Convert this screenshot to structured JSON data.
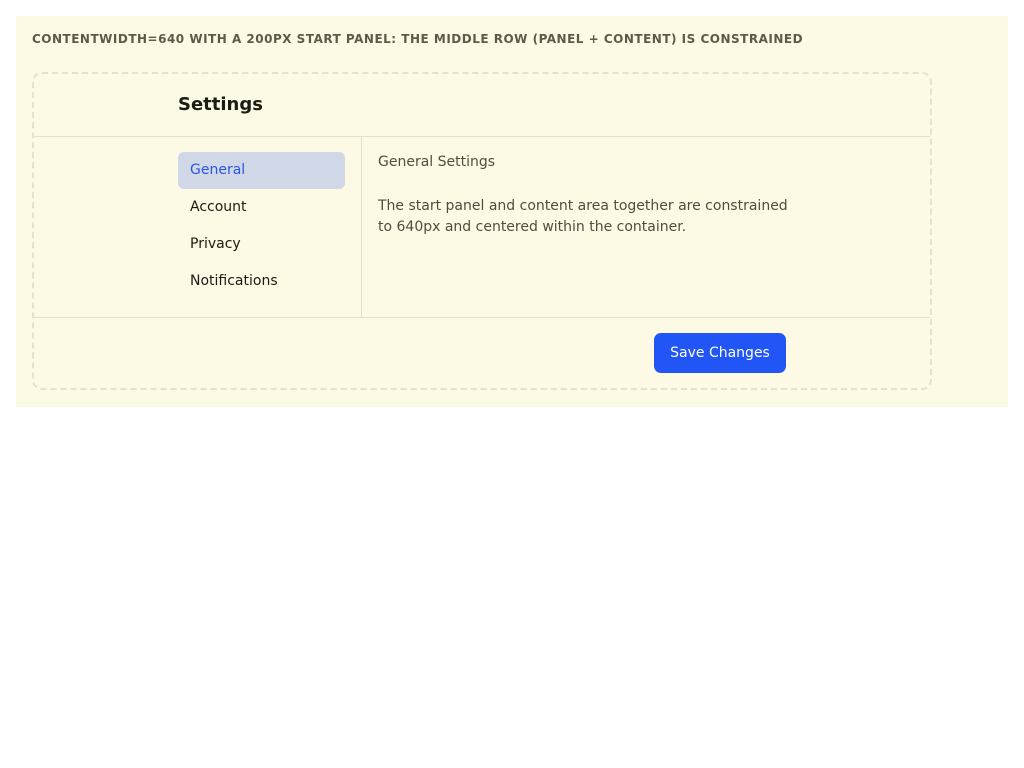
{
  "caption": "CONTENTWIDTH=640 WITH A 200PX START PANEL: THE MIDDLE ROW (PANEL + CONTENT) IS CONSTRAINED",
  "header": {
    "title": "Settings"
  },
  "nav": {
    "items": [
      {
        "label": "General",
        "active": true
      },
      {
        "label": "Account",
        "active": false
      },
      {
        "label": "Privacy",
        "active": false
      },
      {
        "label": "Notifications",
        "active": false
      }
    ]
  },
  "content": {
    "title": "General Settings",
    "body": "The start panel and content area together are constrained to 640px and centered within the container."
  },
  "footer": {
    "save_label": "Save Changes"
  },
  "colors": {
    "accent": "#2155f5",
    "frame_background": "#fcf9e4",
    "active_nav_background": "#d0d8e8",
    "active_nav_text": "#2b56e0"
  }
}
